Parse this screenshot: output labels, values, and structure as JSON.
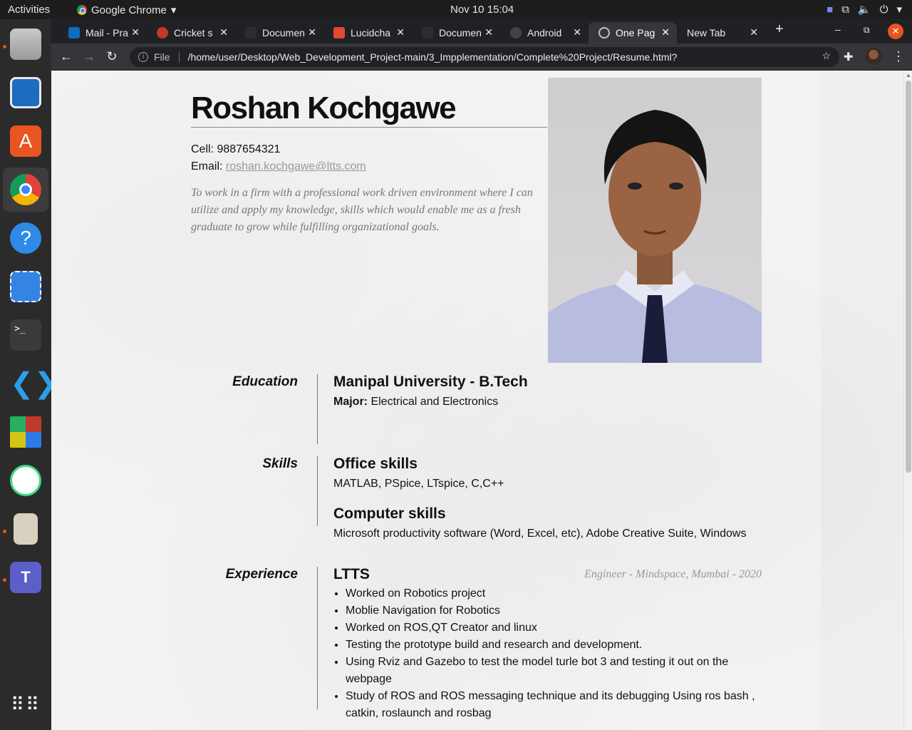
{
  "topbar": {
    "activities": "Activities",
    "app_name": "Google Chrome",
    "clock": "Nov 10  15:04"
  },
  "tabs": [
    {
      "title": "Mail - Pra",
      "color": "#0f6cbd"
    },
    {
      "title": "Cricket s",
      "color": "#c0392b"
    },
    {
      "title": "Documen",
      "color": "#2d2d2d"
    },
    {
      "title": "Lucidcha",
      "color": "#e24a33"
    },
    {
      "title": "Documen",
      "color": "#2d2d2d"
    },
    {
      "title": "Android",
      "color": "#444444"
    },
    {
      "title": "One Pag",
      "color": "#5f6368"
    },
    {
      "title": "New Tab",
      "color": ""
    }
  ],
  "omnibox": {
    "scheme_label": "File",
    "url": "/home/user/Desktop/Web_Development_Project-main/3_Impplementation/Complete%20Project/Resume.html?"
  },
  "resume": {
    "name": "Roshan Kochgawe",
    "cell_label": "Cell: ",
    "cell": "9887654321",
    "email_label": "Email: ",
    "email": "roshan.kochgawe@ltts.com",
    "objective": "To work in a firm with a professional work driven environment where I can utilize and apply my knowledge, skills which would enable me as a fresh graduate to grow while fulfilling organizational goals.",
    "education": {
      "label": "Education",
      "school": "Manipal University - B.Tech",
      "major_label": "Major:",
      "major": " Electrical and Electronics"
    },
    "skills": {
      "label": "Skills",
      "office_title": "Office skills",
      "office": "MATLAB, PSpice, LTspice, C,C++",
      "computer_title": "Computer skills",
      "computer": "Microsoft productivity software (Word, Excel, etc), Adobe Creative Suite, Windows"
    },
    "experience": {
      "label": "Experience",
      "company": "LTTS",
      "meta": "Engineer - Mindspace, Mumbai - 2020",
      "items": [
        "Worked on Robotics project",
        "Moblie Navigation for Robotics",
        "Worked on ROS,QT Creator and linux",
        "Testing the prototype build and research and development.",
        "Using Rviz and Gazebo to test the model turle bot 3 and testing it out on the webpage",
        "Study of ROS and ROS messaging technique and its debugging Using ros bash , catkin, roslaunch and rosbag"
      ]
    }
  }
}
